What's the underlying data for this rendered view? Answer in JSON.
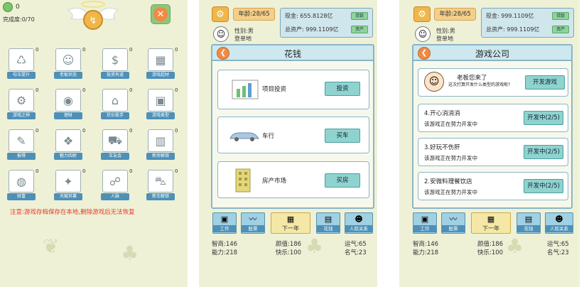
{
  "panel1": {
    "coins": "0",
    "completion": "完成度:0/70",
    "close_symbol": "✕",
    "achievements": [
      {
        "label": "勾玉提升",
        "count": "0",
        "icon": "♺"
      },
      {
        "label": "老板状态",
        "count": "0",
        "icon": "☺"
      },
      {
        "label": "投资有道",
        "count": "0",
        "icon": "$"
      },
      {
        "label": "游戏超材",
        "count": "0",
        "icon": "▦"
      },
      {
        "label": "游戏之神",
        "count": "0",
        "icon": "⚙"
      },
      {
        "label": "理财",
        "count": "0",
        "icon": "◉"
      },
      {
        "label": "炊价能手",
        "count": "0",
        "icon": "⌂"
      },
      {
        "label": "游戏类型",
        "count": "0",
        "icon": "▣"
      },
      {
        "label": "报得",
        "count": "0",
        "icon": "✎"
      },
      {
        "label": "魅力四射",
        "count": "0",
        "icon": "❖"
      },
      {
        "label": "车友会",
        "count": "0",
        "icon": "⛟"
      },
      {
        "label": "新房解锁",
        "count": "0",
        "icon": "▥"
      },
      {
        "label": "财富",
        "count": "0",
        "icon": "◍"
      },
      {
        "label": "天赋异禀",
        "count": "0",
        "icon": "✦"
      },
      {
        "label": "人脉",
        "count": "0",
        "icon": "☍"
      },
      {
        "label": "新车解锁",
        "count": "0",
        "icon": "⛍"
      }
    ],
    "warning": "注意:游戏存档保存在本地,删除游戏后无法恢复"
  },
  "panel2": {
    "age": "年龄:28/65",
    "gender": "性别:男",
    "birthplace": "登单地",
    "cash": "现金: 655.8128亿",
    "cash_btn": "贷款",
    "total_assets": "总资产: 999.1109亿",
    "assets_btn": "资产",
    "title": "花钱",
    "cards": [
      {
        "label": "项目投资",
        "button": "投资",
        "icon": "chart-icon"
      },
      {
        "label": "车行",
        "button": "买车",
        "icon": "car-icon"
      },
      {
        "label": "房产市场",
        "button": "买房",
        "icon": "building-icon"
      }
    ]
  },
  "panel3": {
    "age": "年龄:28/65",
    "gender": "性别:男",
    "birthplace": "登单地",
    "cash": "现金: 999.1109亿",
    "cash_btn": "贷款",
    "total_assets": "总资产: 999.1109亿",
    "assets_btn": "资产",
    "title": "游戏公司",
    "boss_greeting": "老板您来了",
    "boss_question": "这次打算开发什么类型的游戏呢?",
    "develop_btn": "开发游戏",
    "projects": [
      {
        "name": "4.开心消消消",
        "status": "该游戏正在努力开发中",
        "button": "开发中(2/5)"
      },
      {
        "name": "3.好玩不伤肝",
        "status": "该游戏正在努力开发中",
        "button": "开发中(2/5)"
      },
      {
        "name": "2.安微料理餐饮店",
        "status": "该游戏正在努力开发中",
        "button": "开发中(2/5)"
      }
    ]
  },
  "nav": {
    "work": "工作",
    "stocks": "股票",
    "next_year": "下一年",
    "spend": "花钱",
    "relations": "人际关系"
  },
  "stats": {
    "iq": "智商:146",
    "looks": "颜值:186",
    "luck": "运气:65",
    "ability": "能力:218",
    "happiness": "快乐:100",
    "fame": "名气:23"
  },
  "colors": {
    "panel_bg": "#eef1d6",
    "accent_blue": "#4e90b8",
    "warning_red": "#e33b2b",
    "orange": "#f08a45"
  }
}
